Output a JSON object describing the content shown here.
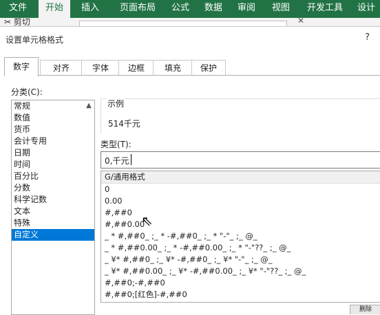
{
  "ribbon": {
    "tabs": [
      {
        "label": "文件"
      },
      {
        "label": "开始"
      },
      {
        "label": "插入"
      },
      {
        "label": "页面布局"
      },
      {
        "label": "公式"
      },
      {
        "label": "数据"
      },
      {
        "label": "审阅"
      },
      {
        "label": "视图"
      },
      {
        "label": "开发工具"
      },
      {
        "label": "设计"
      }
    ],
    "active_tab": "开始",
    "cut_label": "剪切"
  },
  "dialog": {
    "title": "设置单元格格式",
    "help": "?",
    "tabs": [
      {
        "label": "数字"
      },
      {
        "label": "对齐"
      },
      {
        "label": "字体"
      },
      {
        "label": "边框"
      },
      {
        "label": "填充"
      },
      {
        "label": "保护"
      }
    ],
    "active_tab": "数字",
    "category_label": "分类(C):",
    "categories": [
      "常规",
      "数值",
      "货币",
      "会计专用",
      "日期",
      "时间",
      "百分比",
      "分数",
      "科学记数",
      "文本",
      "特殊",
      "自定义"
    ],
    "selected_category": "自定义",
    "sample_title": "示例",
    "sample_value": "514千元",
    "type_label": "类型(T):",
    "type_value": "0,千元",
    "formats": [
      "G/通用格式",
      "0",
      "0.00",
      "#,##0",
      "#,##0.00",
      "_ * #,##0_ ;_ * -#,##0_ ;_ * \"-\"_ ;_ @_",
      "_ * #,##0.00_ ;_ * -#,##0.00_ ;_ * \"-\"??_ ;_ @_",
      "_ ¥* #,##0_ ;_ ¥* -#,##0_ ;_ ¥* \"-\"_ ;_ @_",
      "_ ¥* #,##0.00_ ;_ ¥* -#,##0.00_ ;_ ¥* \"-\"??_ ;_ @_",
      "#,##0;-#,##0",
      "#,##0;[红色]-#,##0"
    ],
    "peek_button": "删除"
  }
}
